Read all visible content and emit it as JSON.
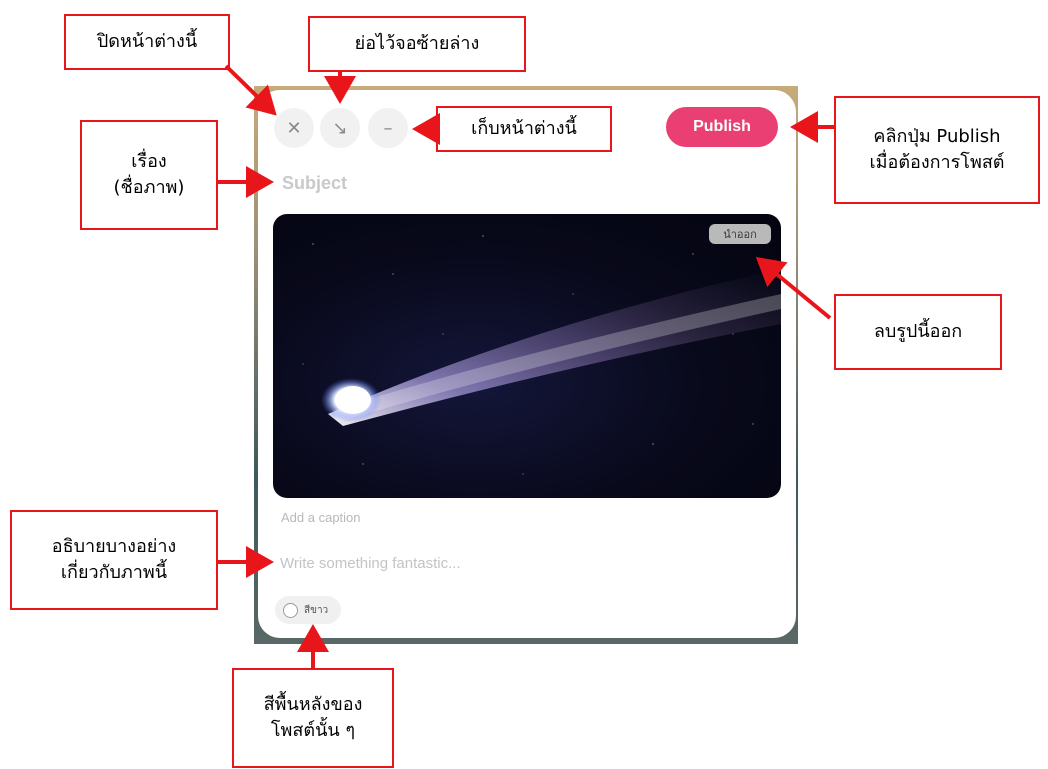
{
  "editor": {
    "publish_label": "Publish",
    "subject_placeholder": "Subject",
    "remove_image_label": "นำออก",
    "caption_placeholder": "Add a caption",
    "body_placeholder": "Write something fantastic...",
    "background_color_label": "สีขาว",
    "icons": {
      "close": "close-icon",
      "minimize_to_corner": "arrow-down-right-icon",
      "collapse": "minus-icon"
    }
  },
  "annotations": {
    "close_window": "ปิดหน้าต่างนี้",
    "minimize_corner": "ย่อไว้จอซ้ายล่าง",
    "collapse_window": "เก็บหน้าต่างนี้",
    "subject_line1": "เรื่อง",
    "subject_line2": "(ชื่อภาพ)",
    "publish_line1": "คลิกปุ่ม Publish",
    "publish_line2": "เมื่อต้องการโพสต์",
    "remove_image": "ลบรูปนี้ออก",
    "description_line1": "อธิบายบางอย่าง",
    "description_line2": "เกี่ยวกับภาพนี้",
    "background_line1": "สีพื้นหลังของ",
    "background_line2": "โพสต์นั้น ๆ"
  },
  "colors": {
    "publish": "#ea3f72",
    "annotation": "#e8161b"
  }
}
